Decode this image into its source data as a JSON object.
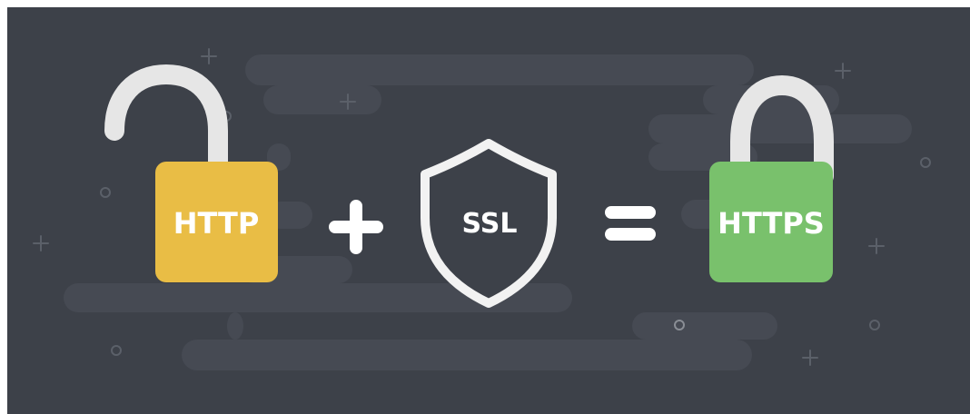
{
  "illustration": {
    "left_lock": {
      "label": "HTTP",
      "color": "#e9bd45",
      "state": "unlocked"
    },
    "shield": {
      "label": "SSL",
      "stroke_color": "#f2f2f2"
    },
    "right_lock": {
      "label": "HTTPS",
      "color": "#79c16c",
      "state": "locked"
    },
    "operators": {
      "plus": "plus-icon",
      "equals": "equals-icon"
    },
    "colors": {
      "background": "#3d4149",
      "streaks": "#464a53",
      "decor": "#5b6069",
      "shackle": "#e6e6e6"
    }
  }
}
